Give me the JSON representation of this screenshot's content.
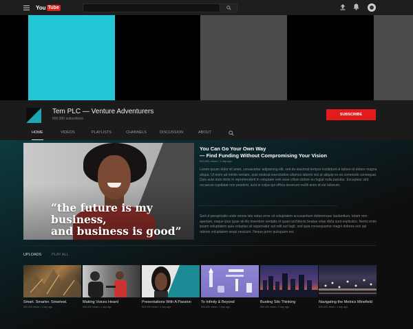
{
  "topbar": {
    "logo_you": "You",
    "logo_tube": "Tube",
    "search_placeholder": ""
  },
  "channel": {
    "title": "Tem PLC — Venture Adventurers",
    "subscribers": "500,000 subscribers",
    "subscribe_label": "SUBSCRIBE"
  },
  "tabs": [
    "HOME",
    "VIDEOS",
    "PLAYLISTS",
    "CHANNELS",
    "DISCUSSION",
    "ABOUT"
  ],
  "featured": {
    "quote_line1": "“the future is my business,",
    "quote_line2": "and business is good”",
    "title_line1": "You Can Go Your Own Way",
    "title_line2": "— Find Funding Without Compromising Your Vision",
    "meta": "500,000 views • 1 day ago",
    "desc1": "Lorem ipsum dolor sit amet, consectetur adipisicing elit, sed do eiusmod tempor incididunt ut labore et dolore magna aliqua. Ut enim ad minim veniam, quis nostrud exercitation ullamco laboris nisi ut aliquip ex ea commodo consequat. Duis aute irure dolor in reprehenderit in voluptate velit esse cillum dolore eu fugiat nulla pariatur. Excepteur sint occaecat cupidatat non proident, sunt in culpa qui officia deserunt mollit anim id est laborum.",
    "desc2": "Sed ut perspiciatis unde omnis iste natus error sit voluptatem accusantium doloremque laudantium, totam rem aperiam, eaque ipsa quae ab illo inventore veritatis et quasi architecto beatae vitae dicta sunt explicabo. Nemo enim ipsam voluptatem quia voluptas sit aspernatur aut odit aut fugit, sed quia consequuntur magni dolores eos qui ratione voluptatem sequi nesciunt. Neque porro quisquam est,"
  },
  "uploads": {
    "tab_uploads": "UPLOADS",
    "tab_play_all": "PLAY ALL",
    "items": [
      {
        "title": "Smart. Smarter. Smartest.",
        "meta": "500,000 views • 1 day ago"
      },
      {
        "title": "Making Voices Heard",
        "meta": "500,000 views • 1 day ago"
      },
      {
        "title": "Presentations With A Passion",
        "meta": "500,000 views • 1 day ago"
      },
      {
        "title": "To Infinity & Beyond",
        "meta": "500,000 views • 1 day ago"
      },
      {
        "title": "Busting Silo Thinking",
        "meta": "500,000 views • 1 day ago"
      },
      {
        "title": "Navigating the Metrics Minefield",
        "meta": "500,000 views • 1 day ago"
      }
    ]
  }
}
